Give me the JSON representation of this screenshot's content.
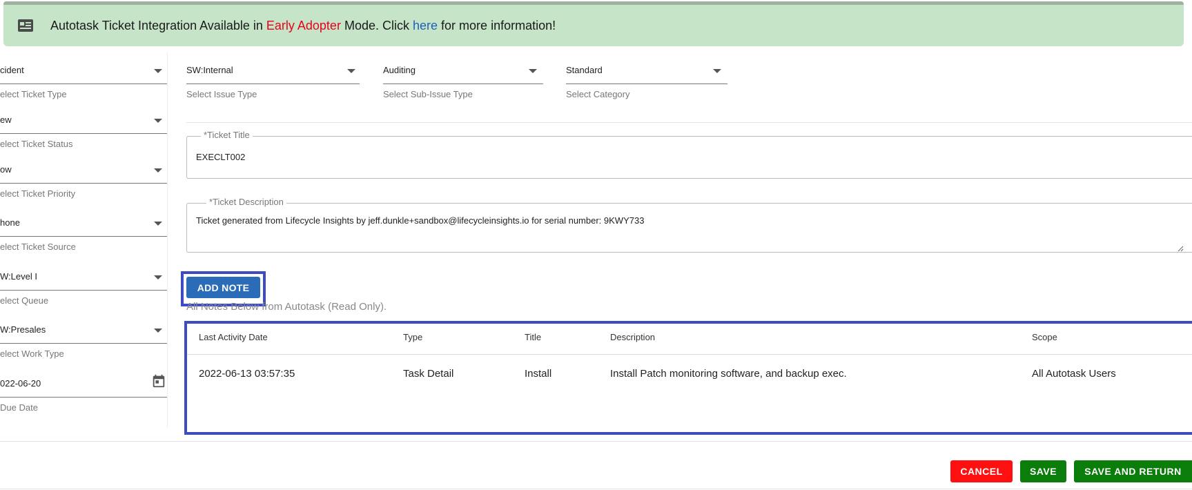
{
  "banner": {
    "icon": "notes-icon",
    "text_before": "Autotask Ticket Integration Available in ",
    "highlight": "Early Adopter",
    "text_mid": " Mode. Click ",
    "link": "here",
    "text_after": " for more information!",
    "colors": {
      "background": "#c6e5c8",
      "highlight": "#e8001c",
      "link": "#1d5fb8"
    }
  },
  "left_fields": [
    {
      "value": "cident",
      "hint": "elect Ticket Type"
    },
    {
      "value": "ew",
      "hint": "elect Ticket Status"
    },
    {
      "value": "ow",
      "hint": "elect Ticket Priority"
    },
    {
      "value": "hone",
      "hint": "elect Ticket Source"
    },
    {
      "value": "W:Level I",
      "hint": "elect Queue"
    },
    {
      "value": "W:Presales",
      "hint": "elect Work Type"
    },
    {
      "value": "022-06-20",
      "hint": "Due Date"
    }
  ],
  "top_selects": {
    "issue_type": {
      "value": "SW:Internal",
      "hint": "Select Issue Type"
    },
    "sub_issue_type": {
      "value": "Auditing",
      "hint": "Select Sub-Issue Type"
    },
    "category": {
      "value": "Standard",
      "hint": "Select Category"
    }
  },
  "ticket_title": {
    "label": "*Ticket Title",
    "value": "EXECLT002"
  },
  "ticket_description": {
    "label": "*Ticket Description",
    "value": "Ticket generated from Lifecycle Insights by jeff.dunkle+sandbox@lifecycleinsights.io for serial number: 9KWY733"
  },
  "notes": {
    "add_button": "ADD NOTE",
    "caption": "All Notes Below from Autotask (Read Only).",
    "columns": [
      "Last Activity Date",
      "Type",
      "Title",
      "Description",
      "Scope"
    ],
    "rows": [
      [
        "2022-06-13 03:57:35",
        "Task Detail",
        "Install",
        "Install Patch monitoring software, and backup exec.",
        "All Autotask Users"
      ]
    ]
  },
  "actions": {
    "cancel": "CANCEL",
    "save": "SAVE",
    "save_and_return": "SAVE AND RETURN",
    "colors": {
      "cancel": "#ff1010",
      "save": "#0a7d0a"
    }
  }
}
